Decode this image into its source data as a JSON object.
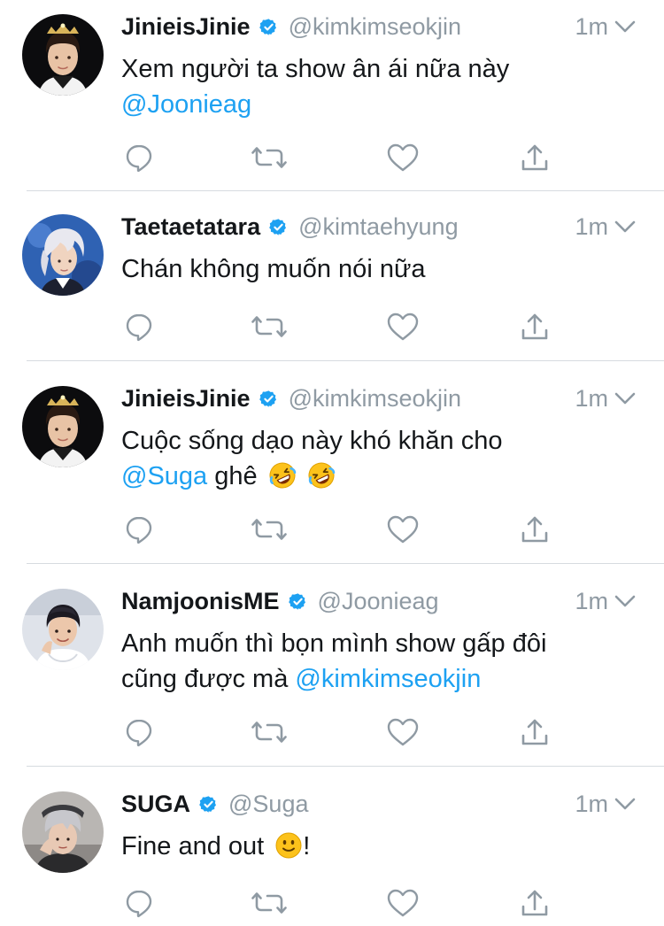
{
  "colors": {
    "link": "#1da1f2",
    "muted": "#8f9aa3",
    "verified": "#1da1f2",
    "text": "#14171a"
  },
  "tweets": [
    {
      "name": "JinieisJinie",
      "handle": "@kimkimseokjin",
      "time": "1m",
      "avatar": "avatar-jin",
      "segments": [
        {
          "type": "text",
          "value": "Xem người ta show ân ái nữa này"
        },
        {
          "type": "br"
        },
        {
          "type": "mention",
          "value": "@Joonieag"
        }
      ]
    },
    {
      "name": "Taetaetatara",
      "handle": "@kimtaehyung",
      "time": "1m",
      "avatar": "avatar-taehyung",
      "segments": [
        {
          "type": "text",
          "value": "Chán không muốn nói nữa"
        }
      ]
    },
    {
      "name": "JinieisJinie",
      "handle": "@kimkimseokjin",
      "time": "1m",
      "avatar": "avatar-jin",
      "segments": [
        {
          "type": "text",
          "value": "Cuộc sống dạo này khó khăn cho"
        },
        {
          "type": "br"
        },
        {
          "type": "mention",
          "value": "@Suga"
        },
        {
          "type": "text",
          "value": " ghê "
        },
        {
          "type": "emoji",
          "value": "rofl-emoji"
        },
        {
          "type": "text",
          "value": " "
        },
        {
          "type": "emoji",
          "value": "rofl-emoji"
        }
      ]
    },
    {
      "name": "NamjoonisME",
      "handle": "@Joonieag",
      "time": "1m",
      "avatar": "avatar-namjoon",
      "segments": [
        {
          "type": "text",
          "value": "Anh muốn thì bọn mình show gấp đôi"
        },
        {
          "type": "br"
        },
        {
          "type": "text",
          "value": "cũng được mà "
        },
        {
          "type": "mention",
          "value": "@kimkimseokjin"
        }
      ]
    },
    {
      "name": "SUGA",
      "handle": "@Suga",
      "time": "1m",
      "avatar": "avatar-suga",
      "segments": [
        {
          "type": "text",
          "value": "Fine and out "
        },
        {
          "type": "emoji",
          "value": "slight-smile-emoji"
        },
        {
          "type": "text",
          "value": "!"
        }
      ]
    }
  ],
  "actions": [
    "reply-icon",
    "retweet-icon",
    "like-icon",
    "share-icon"
  ]
}
